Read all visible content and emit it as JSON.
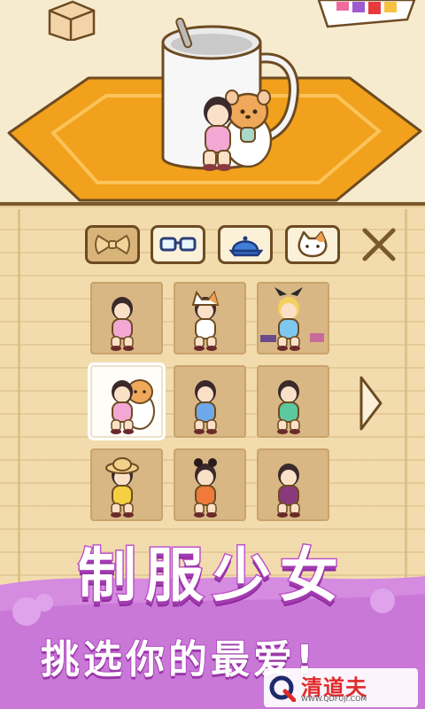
{
  "scene": {
    "description_icons": [
      "box-icon",
      "rug",
      "mug-icon",
      "girl-with-hamster-character"
    ]
  },
  "tabs": [
    {
      "icon": "bow-icon",
      "active": true
    },
    {
      "icon": "glasses-icon",
      "active": false
    },
    {
      "icon": "cap-icon",
      "active": false
    },
    {
      "icon": "cat-mask-icon",
      "active": false
    }
  ],
  "close_icon": "close-x-icon",
  "outfits": [
    {
      "id": "uniform-pink",
      "dress": "#f2a8d3",
      "selected": false
    },
    {
      "id": "cat-costume",
      "dress": "#ffffff",
      "selected": false
    },
    {
      "id": "alice-costume",
      "dress": "#7ec8f0",
      "selected": false
    },
    {
      "id": "hamster-pink",
      "dress": "#f2a8d3",
      "selected": true
    },
    {
      "id": "uniform-blue",
      "dress": "#6fa8e8",
      "selected": false
    },
    {
      "id": "uniform-green",
      "dress": "#5cc8a0",
      "selected": false
    },
    {
      "id": "straw-hat-yellow",
      "dress": "#f5d040",
      "selected": false
    },
    {
      "id": "bun-orange",
      "dress": "#f07a3a",
      "selected": false
    },
    {
      "id": "masked-purple",
      "dress": "#8a3a7a",
      "selected": false
    }
  ],
  "next_icon": "chevron-right-icon",
  "banner": {
    "title": "制服少女",
    "subtitle": "挑选你的最爱!"
  },
  "watermark": {
    "name": "清道夫",
    "url": "WWW.QDFUJI.COM"
  },
  "colors": {
    "panel": "#f2dcae",
    "border": "#6d4b22",
    "rug": "#f5a623",
    "banner": "#d68ee0"
  }
}
